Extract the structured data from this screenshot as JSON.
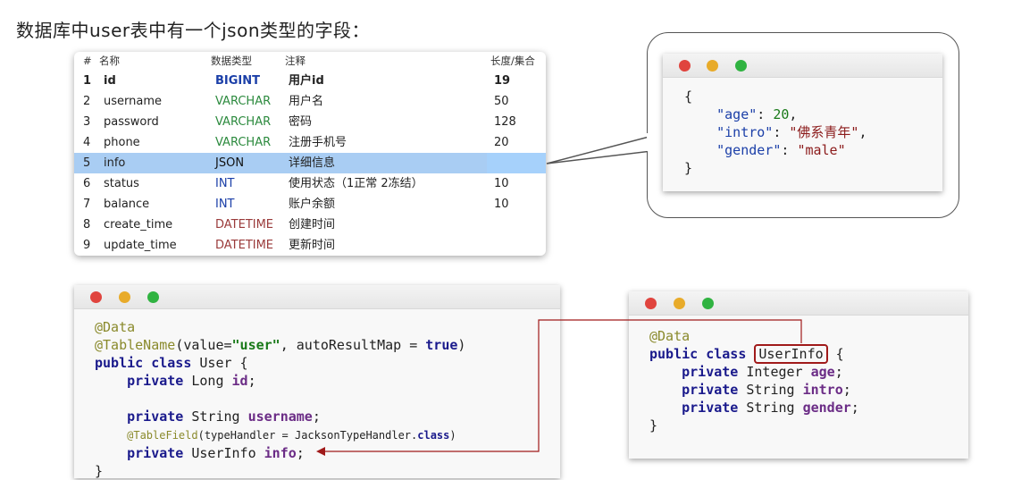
{
  "title": "数据库中user表中有一个json类型的字段：",
  "table": {
    "headers": [
      "#",
      "名称",
      "数据类型",
      "注释",
      "长度/集合"
    ],
    "rows": [
      {
        "num": "1",
        "name": "id",
        "type": "BIGINT",
        "note": "用户id",
        "len": "19"
      },
      {
        "num": "2",
        "name": "username",
        "type": "VARCHAR",
        "note": "用户名",
        "len": "50"
      },
      {
        "num": "3",
        "name": "password",
        "type": "VARCHAR",
        "note": "密码",
        "len": "128"
      },
      {
        "num": "4",
        "name": "phone",
        "type": "VARCHAR",
        "note": "注册手机号",
        "len": "20"
      },
      {
        "num": "5",
        "name": "info",
        "type": "JSON",
        "note": "详细信息",
        "len": ""
      },
      {
        "num": "6",
        "name": "status",
        "type": "INT",
        "note": "使用状态（1正常 2冻结）",
        "len": "10"
      },
      {
        "num": "7",
        "name": "balance",
        "type": "INT",
        "note": "账户余额",
        "len": "10"
      },
      {
        "num": "8",
        "name": "create_time",
        "type": "DATETIME",
        "note": "创建时间",
        "len": ""
      },
      {
        "num": "9",
        "name": "update_time",
        "type": "DATETIME",
        "note": "更新时间",
        "len": ""
      }
    ],
    "selected_row": "5",
    "colors": {
      "selection": "#a9cdf3",
      "bigint": "#1b3fa8",
      "varchar": "#2c8a3e",
      "datetime": "#9a3a3a"
    }
  },
  "json_example": {
    "open": "{",
    "close": "}",
    "fields": [
      {
        "key": "\"age\"",
        "value": "20",
        "sep": ","
      },
      {
        "key": "\"intro\"",
        "value": "\"佛系青年\"",
        "sep": ","
      },
      {
        "key": "\"gender\"",
        "value": "\"male\"",
        "sep": ""
      }
    ]
  },
  "user_class": {
    "ann_data": "@Data",
    "ann_tablename": "@TableName",
    "tablename_args_pre": "(value=",
    "tablename_value": "\"user\"",
    "tablename_args_mid": ", autoResultMap = ",
    "tablename_true": "true",
    "tablename_args_post": ")",
    "decl_kw": "public class",
    "decl_name": " User {",
    "f1_kw": "private",
    "f1_type": " Long ",
    "f1_name": "id",
    "f1_end": ";",
    "f2_kw": "private",
    "f2_type": " String ",
    "f2_name": "username",
    "f2_end": ";",
    "ann_tablefield": "@TableField",
    "tablefield_args": "(typeHandler = JacksonTypeHandler.",
    "tablefield_class": "class",
    "tablefield_end": ")",
    "f3_kw": "private",
    "f3_type": " UserInfo ",
    "f3_name": "info",
    "f3_end": ";",
    "close": "}"
  },
  "userinfo_class": {
    "ann_data": "@Data",
    "decl_kw": "public class",
    "decl_name": "UserInfo",
    "decl_open": " {",
    "f1_kw": "private",
    "f1_type": " Integer ",
    "f1_name": "age",
    "f2_kw": "private",
    "f2_type": " String ",
    "f2_name": "intro",
    "f3_kw": "private",
    "f3_type": " String ",
    "f3_name": "gender",
    "end": ";",
    "close": "}"
  },
  "colors": {
    "arrow": "#a01a1a",
    "keyword": "#1a1a8c",
    "annotation": "#8a8a2c"
  }
}
